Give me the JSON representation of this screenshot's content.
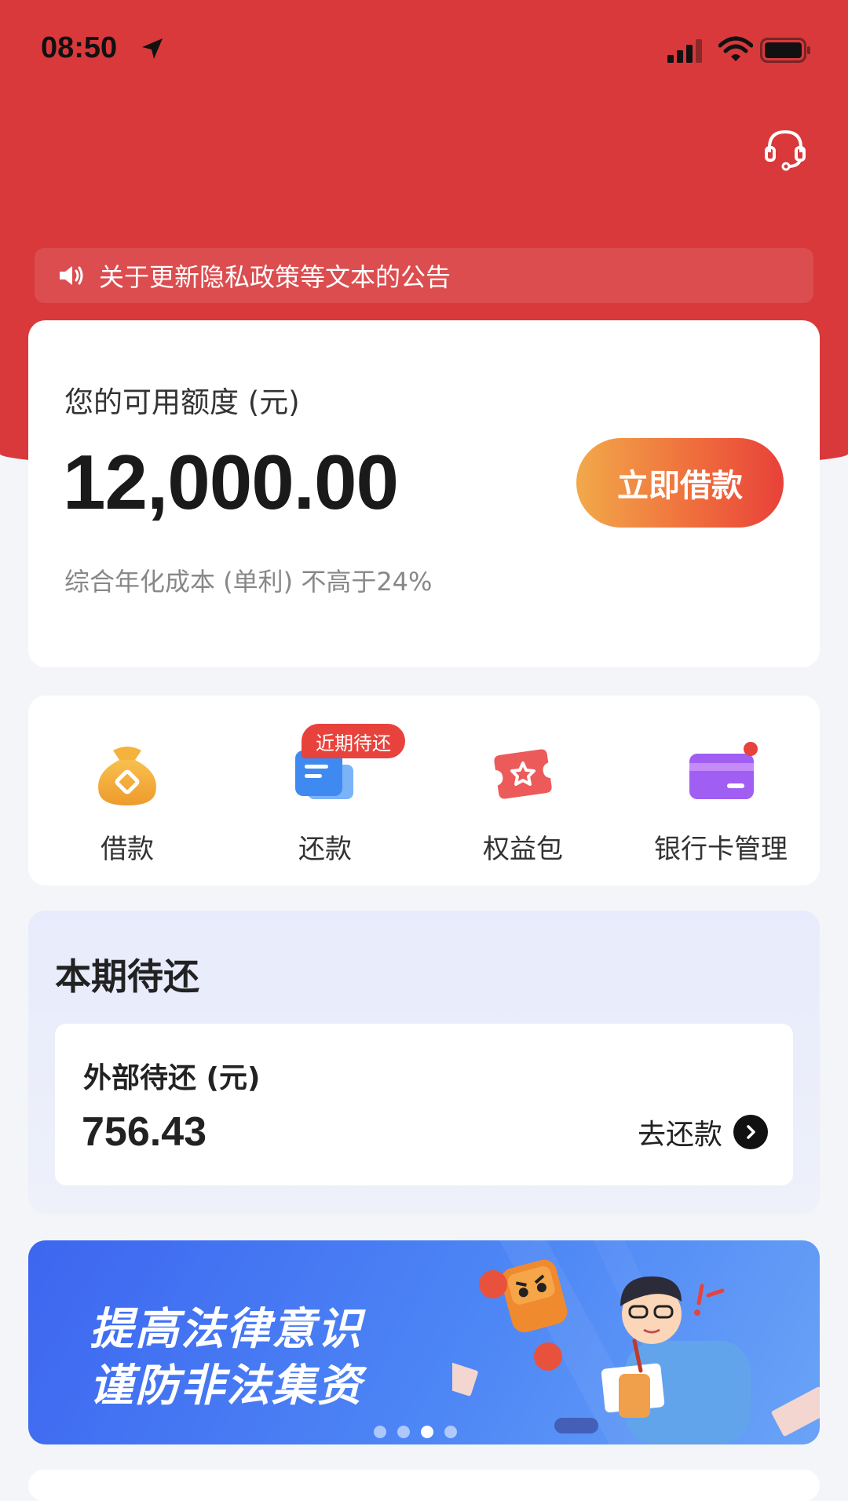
{
  "status_bar": {
    "time": "08:50",
    "icons": [
      "location-arrow-icon",
      "signal-icon",
      "wifi-icon",
      "battery-icon"
    ]
  },
  "header": {
    "support_icon": "headset-icon",
    "notice": {
      "icon": "speaker-icon",
      "text": "关于更新隐私政策等文本的公告"
    }
  },
  "credit": {
    "label": "您的可用额度 (元)",
    "amount": "12,000.00",
    "button_label": "立即借款",
    "note": "综合年化成本 (单利) 不高于24%"
  },
  "quick_menu": {
    "items": [
      {
        "label": "借款",
        "icon": "money-bag-icon"
      },
      {
        "label": "还款",
        "icon": "repay-card-icon"
      },
      {
        "label": "权益包",
        "icon": "coupon-icon"
      },
      {
        "label": "银行卡管理",
        "icon": "bank-card-icon"
      }
    ],
    "badge": "近期待还"
  },
  "repay": {
    "title": "本期待还",
    "card_label": "外部待还 (元)",
    "amount": "756.43",
    "action_label": "去还款"
  },
  "banner": {
    "line1": "提高法律意识",
    "line2": "谨防非法集资",
    "total_slides": 4,
    "active_slide": 3
  },
  "colors": {
    "brand_red": "#d9393b",
    "button_gradient_start": "#f2a94a",
    "button_gradient_end": "#e8413a",
    "banner_blue": "#3d66f0"
  }
}
